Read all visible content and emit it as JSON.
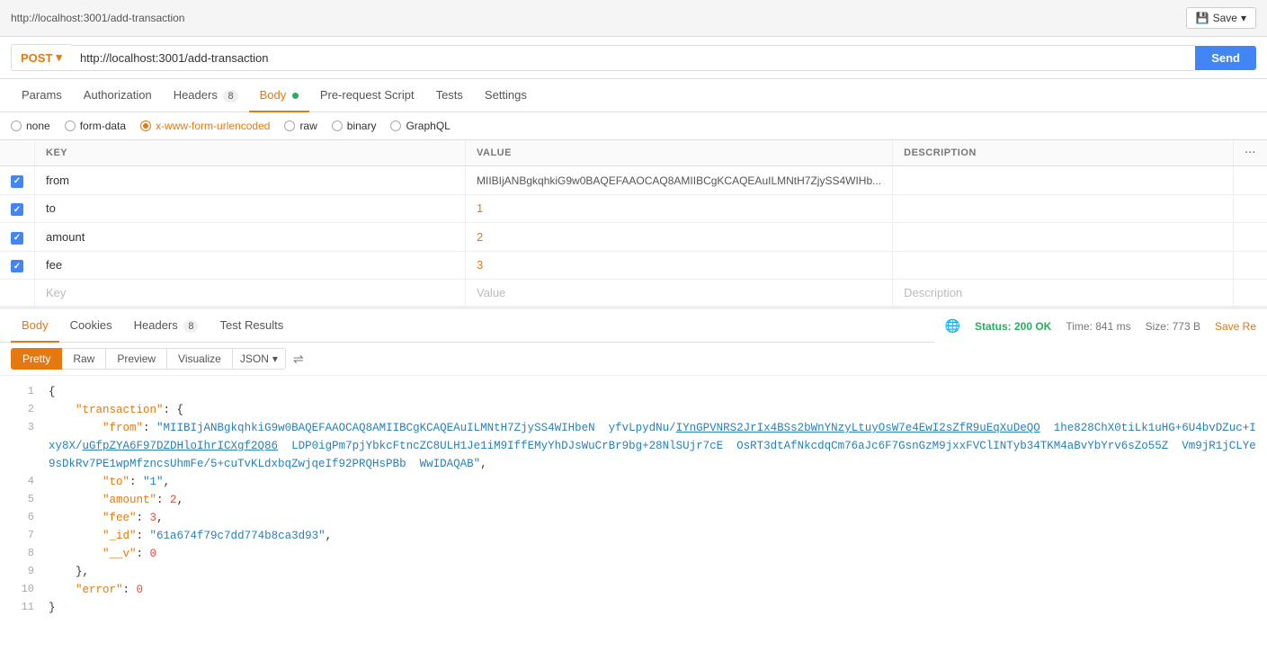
{
  "topbar": {
    "url": "http://localhost:3001/add-transaction",
    "save_label": "Save"
  },
  "request": {
    "method": "POST",
    "url": "http://localhost:3001/add-transaction",
    "send_label": "Send"
  },
  "tabs": [
    {
      "label": "Params",
      "active": false,
      "badge": null
    },
    {
      "label": "Authorization",
      "active": false,
      "badge": null
    },
    {
      "label": "Headers",
      "active": false,
      "badge": "8"
    },
    {
      "label": "Body",
      "active": true,
      "badge": null,
      "dot": true
    },
    {
      "label": "Pre-request Script",
      "active": false,
      "badge": null
    },
    {
      "label": "Tests",
      "active": false,
      "badge": null
    },
    {
      "label": "Settings",
      "active": false,
      "badge": null
    }
  ],
  "body_types": [
    {
      "label": "none",
      "checked": false
    },
    {
      "label": "form-data",
      "checked": false
    },
    {
      "label": "x-www-form-urlencoded",
      "checked": true
    },
    {
      "label": "raw",
      "checked": false
    },
    {
      "label": "binary",
      "checked": false
    },
    {
      "label": "GraphQL",
      "checked": false
    }
  ],
  "table": {
    "columns": [
      "KEY",
      "VALUE",
      "DESCRIPTION",
      "..."
    ],
    "rows": [
      {
        "checked": true,
        "key": "from",
        "value": "MIIBIjANBgkqhkiG9w0BAQEFAAOCAQ8AMIIBCgKCAQEAuILMNtH7ZjySS4WIHb...",
        "description": ""
      },
      {
        "checked": true,
        "key": "to",
        "value": "1",
        "description": ""
      },
      {
        "checked": true,
        "key": "amount",
        "value": "2",
        "description": ""
      },
      {
        "checked": true,
        "key": "fee",
        "value": "3",
        "description": ""
      },
      {
        "checked": false,
        "key": "",
        "value": "",
        "description": ""
      }
    ],
    "placeholder_key": "Key",
    "placeholder_value": "Value",
    "placeholder_desc": "Description"
  },
  "response": {
    "tabs": [
      {
        "label": "Body",
        "active": true
      },
      {
        "label": "Cookies",
        "active": false
      },
      {
        "label": "Headers",
        "active": false,
        "badge": "8"
      },
      {
        "label": "Test Results",
        "active": false
      }
    ],
    "status": "Status: 200 OK",
    "time": "Time: 841 ms",
    "size": "Size: 773 B",
    "save_label": "Save Re",
    "format_tabs": [
      "Pretty",
      "Raw",
      "Preview",
      "Visualize"
    ],
    "active_format": "Pretty",
    "json_label": "JSON",
    "json_lines": [
      {
        "num": 1,
        "content": "{"
      },
      {
        "num": 2,
        "content": "    \"transaction\": {"
      },
      {
        "num": 3,
        "content": "        \"from\": \"MIIBIjANBgkqhkiG9w0BAQEFAAOCAQ8AMIIBCgKCAQEAuILMNtH7ZjySS4WIHbeN  yfvLpydNu/IYnGPVNRS2JrIx4BSs2bWnYNzyLtuyOsW7e4EwI2sZfR9uEqXuDeQO  1he828ChX0tiLk1uHG+6U4bvDZuc+Ixy8X/uGfpZYA6F97DZDHloIhrICXgf2Q86  LDP0igPm7pjYbkcFtncZC8ULH1Je1iM9IffEMyYhDJsWuCrBr9bg+28NlSUjr7cE  OsRT3dtAfNkcdqCm76aJc6F7GsnGzM9jxxFVClINTyb34TKM4aBvYbYrv6sZo55Z  Vm9jR1jCLYe9sDkRv7PE1wpMfzncsUhmFe/5+cuTvKLdxbqZwjqeIf92PRQHsPBb  WwIDAQAB\","
      },
      {
        "num": 4,
        "content": "        \"to\": \"1\","
      },
      {
        "num": 5,
        "content": "        \"amount\": 2,"
      },
      {
        "num": 6,
        "content": "        \"fee\": 3,"
      },
      {
        "num": 7,
        "content": "        \"_id\": \"61a674f79c7dd774b8ca3d93\","
      },
      {
        "num": 8,
        "content": "        \"__v\": 0"
      },
      {
        "num": 9,
        "content": "    },"
      },
      {
        "num": 10,
        "content": "    \"error\": 0"
      },
      {
        "num": 11,
        "content": "}"
      }
    ]
  }
}
